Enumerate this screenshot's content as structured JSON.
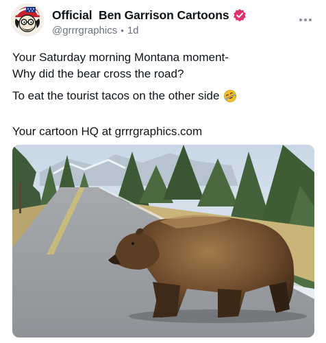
{
  "post": {
    "author": {
      "display_name": "Official  Ben Garrison Cartoons",
      "handle": "@grrrgraphics",
      "separator": "•",
      "age": "1d",
      "avatar_icon": "cartoon-avatar-icon",
      "verified_icon": "verified-badge-icon",
      "verified_color": "#e1306c"
    },
    "menu_icon": "more-options-icon",
    "body": {
      "line1": "Your Saturday morning Montana moment-",
      "line2": "Why did the bear cross the road?",
      "line3": "To eat the tourist tacos on the other side",
      "line3_emoji": "rolling-on-floor-laughing-emoji",
      "line4": "Your cartoon HQ at grrrgraphics.com"
    },
    "media": {
      "image_icon": "photo-grizzly-bear-crossing-road"
    }
  }
}
